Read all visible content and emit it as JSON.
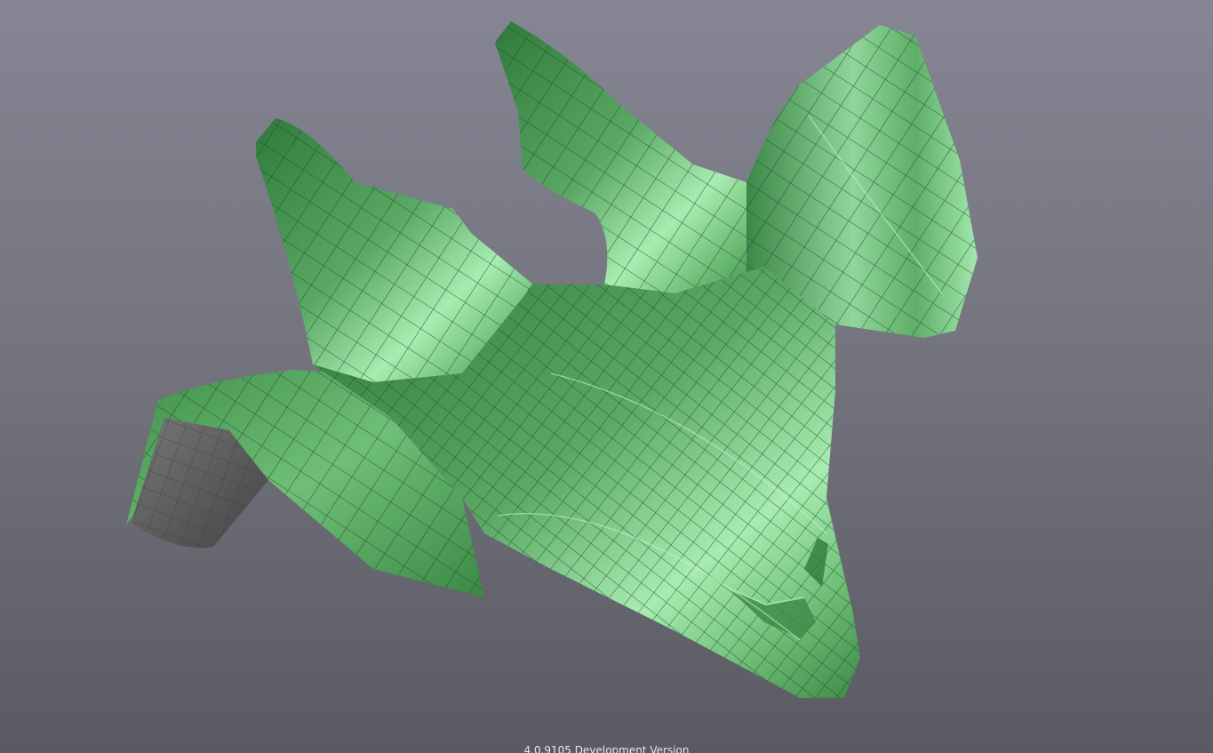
{
  "viewport": {
    "background_top_color": "#858594",
    "background_bottom_color": "#5a5a63",
    "model_color": "#4f9e58",
    "model_highlight_color": "#a8ecb0",
    "wireframe_color": "#1f4a24",
    "backface_color": "#5e5e5e"
  },
  "status": {
    "version_text": "4.0.9105 Development Version"
  }
}
